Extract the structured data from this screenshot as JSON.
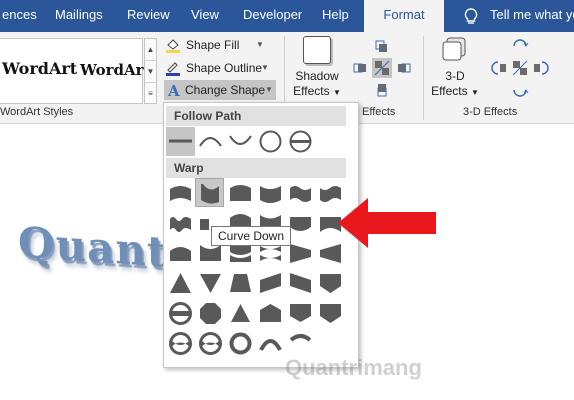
{
  "tabs": [
    {
      "label": "ences",
      "active": false
    },
    {
      "label": "Mailings",
      "active": false
    },
    {
      "label": "Review",
      "active": false
    },
    {
      "label": "View",
      "active": false
    },
    {
      "label": "Developer",
      "active": false
    },
    {
      "label": "Help",
      "active": false
    },
    {
      "label": "Format",
      "active": true
    }
  ],
  "tell_me": "Tell me what you",
  "wordart_gallery": {
    "sample1": "WordArt",
    "sample2": "WordArt",
    "group_label": "WordArt Styles"
  },
  "text_controls": {
    "shape_fill": "Shape Fill",
    "shape_outline": "Shape Outline",
    "change_shape": "Change Shape"
  },
  "shadow_effects": {
    "line1": "Shadow",
    "line2": "Effects",
    "group_label": "Effects"
  },
  "three_d_effects": {
    "line1": "3-D",
    "line2": "Effects",
    "group_label": "3-D Effects"
  },
  "document": {
    "wordart_text": "Quantri"
  },
  "change_shape_menu": {
    "follow_path_label": "Follow Path",
    "warp_label": "Warp",
    "hovered_tooltip": "Curve Down"
  },
  "watermark": "Quantrimang",
  "colors": {
    "ribbon_tab_blue": "#2b579a",
    "arrow_red": "#e8181c",
    "shape_gray": "#595959"
  }
}
